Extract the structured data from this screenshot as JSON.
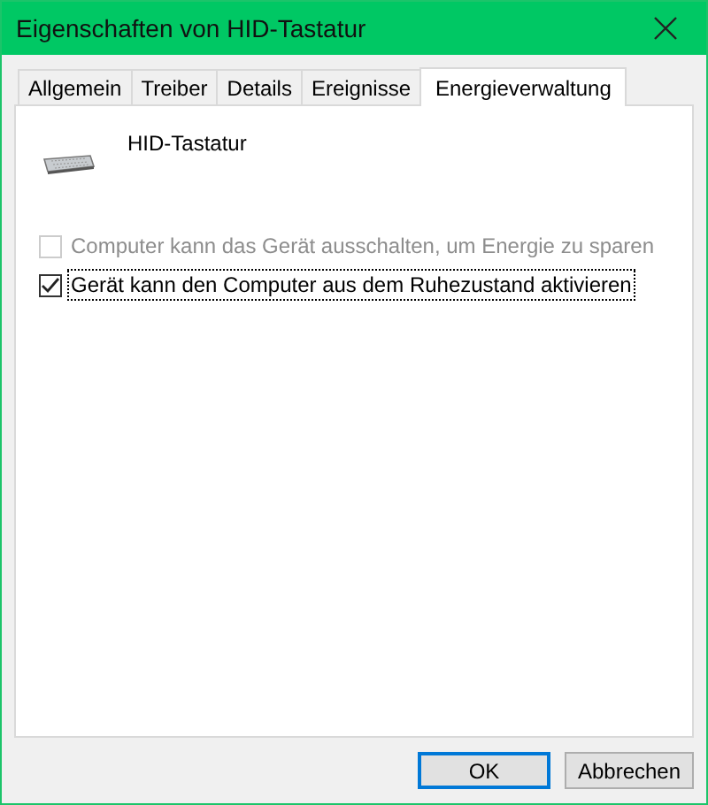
{
  "window": {
    "title": "Eigenschaften von HID-Tastatur"
  },
  "tabs": [
    {
      "label": "Allgemein",
      "selected": false
    },
    {
      "label": "Treiber",
      "selected": false
    },
    {
      "label": "Details",
      "selected": false
    },
    {
      "label": "Ereignisse",
      "selected": false
    },
    {
      "label": "Energieverwaltung",
      "selected": true
    }
  ],
  "device": {
    "name": "HID-Tastatur"
  },
  "options": [
    {
      "label": "Computer kann das Gerät ausschalten, um Energie zu sparen",
      "checked": false,
      "disabled": true,
      "focused": false
    },
    {
      "label": "Gerät kann den Computer aus dem Ruhezustand aktivieren",
      "checked": true,
      "disabled": false,
      "focused": true
    }
  ],
  "buttons": [
    {
      "label": "OK",
      "default": true
    },
    {
      "label": "Abbrechen",
      "default": false
    }
  ]
}
